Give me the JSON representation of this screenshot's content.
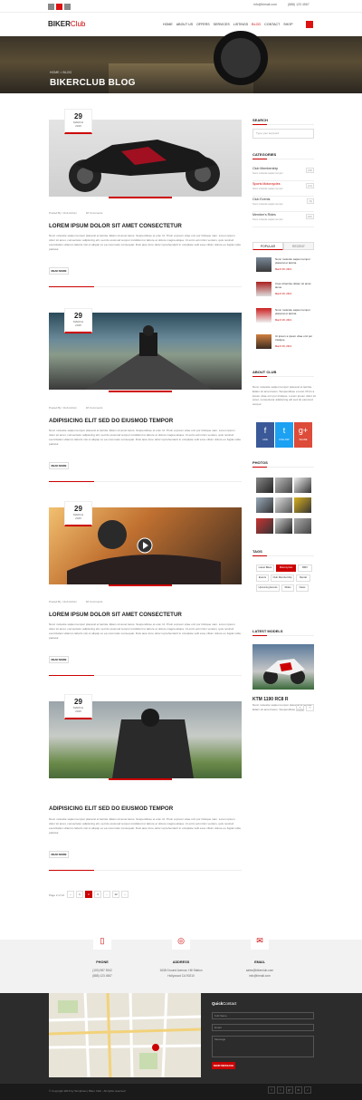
{
  "topbar": {
    "email": "info@bimail.com",
    "phone": "(888) 123 4567"
  },
  "header": {
    "logo_main": "BIKER",
    "logo_accent": "Club",
    "nav": [
      "HOME",
      "ABOUT US",
      "OFFERS",
      "SERVICES",
      "LISTINGS",
      "BLOG",
      "CONTACT",
      "SHOP"
    ],
    "active_nav": "BLOG"
  },
  "banner": {
    "breadcrumb": "HOME  >  BLOG",
    "title": "BIKERCLUB BLOG"
  },
  "posts": [
    {
      "day": "29",
      "month": "MARCH",
      "year": "2015",
      "author": "Posted By: Club Admin",
      "comments": "18 Comments",
      "title": "LOREM IPSUM DOLOR SIT AMET CONSECTETUR",
      "excerpt": "Nunc molestie sapien tempor placerat et lacinia. Etiam sit amet lacus. Suspendisse et erat. Ut. Proin a ipsum vitae orci por tristique nam. Lorem ipsum dolor sit amet, consectetur adipiscing elit, sed do eiusmod tempor incididunt ut labore et dolore magna aliqua. Ut enim ad minim veniam, quis nostrud exercitation ullamco laboris nisi ut aliquip ex ea commodo consequat. Duis aute irure dolor reprehenderit in voluptate velit esse cillum dolore eu fugiat nulla pariatur.",
      "readmore": "READ MORE"
    },
    {
      "day": "29",
      "month": "MARCH",
      "year": "2015",
      "author": "Posted By: Club Admin",
      "comments": "18 Comments",
      "title": "ADIPISICING ELIT SED DO EIUSMOD TEMPOR",
      "excerpt": "Nunc molestie sapien tempor placerat et lacinia. Etiam sit amet lacus. Suspendisse et erat. Ut. Proin a ipsum vitae orci por tristique nam. Lorem ipsum dolor sit amet, consectetur adipiscing elit, sed do eiusmod tempor incididunt ut labore et dolore magna aliqua. Ut enim ad minim veniam, quis nostrud exercitation ullamco laboris nisi ut aliquip ex ea commodo consequat. Duis aute irure dolor reprehenderit in voluptate velit esse cillum dolore eu fugiat nulla pariatur.",
      "readmore": "READ MORE"
    },
    {
      "day": "29",
      "month": "MARCH",
      "year": "2015",
      "author": "Posted By: Club Admin",
      "comments": "18 Comments",
      "title": "LOREM IPSUM DOLOR SIT AMET CONSECTETUR",
      "excerpt": "Nunc molestie sapien tempor placerat et lacinia. Etiam sit amet lacus. Suspendisse et erat. Ut. Proin a ipsum vitae orci por tristique nam. Lorem ipsum dolor sit amet, consectetur adipiscing elit, sed do eiusmod tempor incididunt ut labore et dolore magna aliqua. Ut enim ad minim veniam, quis nostrud exercitation ullamco laboris nisi ut aliquip ex ea commodo consequat. Duis aute irure dolor reprehenderit in voluptate velit esse cillum dolore eu fugiat nulla pariatur.",
      "readmore": "READ MORE"
    },
    {
      "day": "29",
      "month": "MARCH",
      "year": "2015",
      "author": "",
      "comments": "",
      "title": "ADIPISICING ELIT SED DO EIUSMOD TEMPOR",
      "excerpt": "Nunc molestie sapien tempor placerat et lacinia. Etiam sit amet lacus. Suspendisse et erat. Ut. Proin a ipsum vitae orci por tristique nam. Lorem ipsum dolor sit amet, consectetur adipiscing elit, sed do eiusmod tempor incididunt ut labore et dolore magna aliqua. Ut enim ad minim veniam, quis nostrud exercitation ullamco laboris nisi ut aliquip ex ea commodo consequat. Duis aute irure dolor reprehenderit in voluptate velit esse cillum dolore eu fugiat nulla pariatur.",
      "readmore": "READ MORE"
    }
  ],
  "sidebar": {
    "search_title": "SEARCH",
    "search_placeholder": "Type your keyword",
    "categories_title": "CATEGORIES",
    "categories": [
      {
        "name": "Club Membership",
        "sub": "Nunc molestie sapien tempor",
        "count": "(18)"
      },
      {
        "name": "Sports Motorcycles",
        "sub": "Nunc molestie sapien tempor",
        "count": "(11)"
      },
      {
        "name": "Club Events",
        "sub": "Nunc molestie sapien tempor",
        "count": "(9)"
      },
      {
        "name": "Member's Rides",
        "sub": "Nunc molestie sapien tempor",
        "count": "(20)"
      }
    ],
    "active_category": "Sports Motorcycles",
    "tab_popular": "POPULAR",
    "tab_recent": "RECENT",
    "popular": [
      {
        "title": "Nunc molestie sapien tempor placerat et lacinia",
        "date": "March 30, 2013"
      },
      {
        "title": "Cras id lacinia. Etiam sit amet lacus.",
        "date": "March 30, 2013"
      },
      {
        "title": "Nunc molestie sapien tempor placerat et lacinia",
        "date": "March 30, 2013"
      },
      {
        "title": "Ut ipsum a ipsum vitae orci por tristique",
        "date": "March 30, 2013"
      }
    ],
    "about_title": "ABOUT CLUB",
    "about_text": "Nunc molestie sapien tempor placerat et lacinia. Etiam sit amet lacus. Suspendisse et erat. Proin a ipsum vitae orci por tristique. Lorem ipsum dolor sit amet, consectetur adipiscing elit sed do eiusmod tempor.",
    "social": [
      {
        "icon": "f",
        "label": "LIKE",
        "color": "#3b5998"
      },
      {
        "icon": "t",
        "label": "FOLLOW",
        "color": "#1da1f2"
      },
      {
        "icon": "g+",
        "label": "SHARE",
        "color": "#dd4b39"
      }
    ],
    "photos_title": "PHOTOS",
    "tags_title": "TAGS",
    "tags": [
      "Latest Bikes",
      "Motorcycles",
      "BMX",
      "Events",
      "Club Membership",
      "Rental",
      "Upcoming Events",
      "Rides",
      "News"
    ],
    "active_tag": "Motorcycles",
    "latest_title": "LATEST MODELS",
    "model_name": "KTM 1190 RC8 R",
    "model_text": "Nunc molestie sapien tempor placerat et lacinia. Etiam sit amet lacus. Suspendisse et erat."
  },
  "pagination": {
    "label": "Page 2 of 12",
    "pages": [
      "‹",
      "1",
      "2",
      "3",
      "...",
      "12",
      "›"
    ],
    "active": "2"
  },
  "contact": [
    {
      "icon": "▯",
      "title": "PHONE",
      "lines": [
        "(100) 987 5342",
        "(888) 123 4567"
      ]
    },
    {
      "icon": "◎",
      "title": "ADDRESS",
      "lines": [
        "1638 Ground Avenue, Hill Station",
        "Hollywood CA 90210"
      ]
    },
    {
      "icon": "✉",
      "title": "EMAIL",
      "lines": [
        "sales@bikerclub.com",
        "info@bimail.com"
      ]
    }
  ],
  "footer": {
    "quick_title_1": "Quick",
    "quick_title_2": "Contact",
    "name_ph": "Full Name",
    "email_ph": "Email",
    "message_ph": "Message",
    "send": "SEND MESSAGE",
    "copyright": "© Copyright 2015 by Templines | Biker Club - All rights reserved",
    "social": [
      "f",
      "t",
      "g+",
      "in",
      "✓"
    ]
  }
}
